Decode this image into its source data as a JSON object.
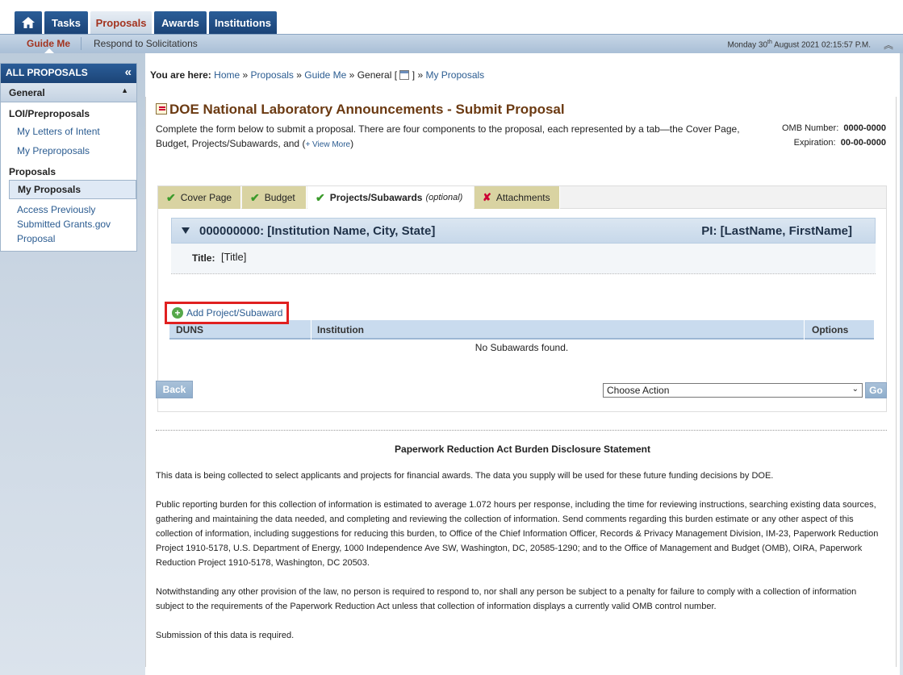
{
  "topnav": {
    "tabs": [
      {
        "label": "Tasks"
      },
      {
        "label": "Proposals"
      },
      {
        "label": "Awards"
      },
      {
        "label": "Institutions"
      }
    ]
  },
  "subnav": {
    "guide_me": "Guide Me",
    "respond": "Respond to Solicitations",
    "date_day": "Monday 30",
    "date_sup": "th",
    "date_rest": " August 2021 02:15:57 P.M."
  },
  "sidebar": {
    "header": "ALL PROPOSALS",
    "section": "General",
    "group1": "LOI/Preproposals",
    "link1": "My Letters of Intent",
    "link2": "My Preproposals",
    "group2": "Proposals",
    "active_link": "My Proposals",
    "link3_line1": "Access Previously",
    "link3_line2": "Submitted Grants.gov",
    "link3_line3": "Proposal"
  },
  "breadcrumb": {
    "prefix": "You are here:",
    "home": "Home",
    "proposals": "Proposals",
    "guide_me": "Guide Me",
    "general": "General [",
    "close": "]",
    "my_proposals": "My Proposals",
    "sep": "»"
  },
  "page": {
    "title": "DOE National Laboratory Announcements - Submit Proposal",
    "desc": "Complete the form below to submit a proposal. There are four components to the proposal, each represented by a tab—the Cover Page, Budget, Projects/Subawards, and (",
    "view_more": "+ View More",
    "desc_end": ")",
    "omb_label": "OMB Number:",
    "omb_value": "0000-0000",
    "exp_label": "Expiration:",
    "exp_value": "00-00-0000"
  },
  "tabs": {
    "cover": "Cover Page",
    "budget": "Budget",
    "projects": "Projects/Subawards",
    "optional": "(optional)",
    "attachments": "Attachments"
  },
  "institution": {
    "name": "000000000: [Institution Name, City, State]",
    "pi": "PI: [LastName, FirstName]",
    "title_label": "Title:",
    "title_value": "[Title]"
  },
  "subawards": {
    "add_label": "Add Project/Subaward",
    "col_duns": "DUNS",
    "col_institution": "Institution",
    "col_options": "Options",
    "empty": "No Subawards found."
  },
  "actions": {
    "back": "Back",
    "choose": "Choose Action",
    "go": "Go"
  },
  "disclosure": {
    "title": "Paperwork Reduction Act Burden Disclosure Statement",
    "p1": "This data is being collected to select applicants and projects for financial awards. The data you supply will be used for these future funding decisions by DOE.",
    "p2": "Public reporting burden for this collection of information is estimated to average 1.072 hours per response, including the time for reviewing instructions, searching existing data sources, gathering and maintaining the data needed, and completing and reviewing the collection of information. Send comments regarding this burden estimate or any other aspect of this collection of information, including suggestions for reducing this burden, to Office of the Chief Information Officer, Records & Privacy Management Division, IM-23, Paperwork Reduction Project 1910-5178, U.S. Department of Energy, 1000 Independence Ave SW, Washington, DC, 20585-1290; and to the Office of Management and Budget (OMB), OIRA, Paperwork Reduction Project 1910-5178, Washington, DC 20503.",
    "p3": "Notwithstanding any other provision of the law, no person is required to respond to, nor shall any person be subject to a penalty for failure to comply with a collection of information subject to the requirements of the Paperwork Reduction Act unless that collection of information displays a currently valid OMB control number.",
    "p4": "Submission of this data is required."
  }
}
